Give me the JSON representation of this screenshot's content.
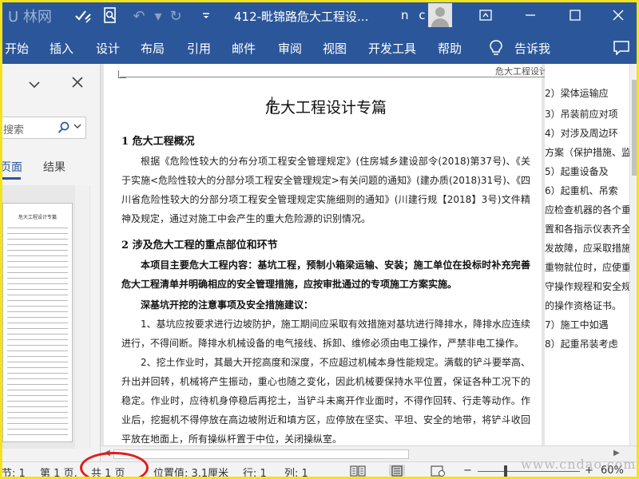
{
  "titlebar": {
    "watermark": "U 林网",
    "doc_title": "412-毗锦路危大工程设...",
    "user_initials": "n c"
  },
  "ribbon": {
    "tabs": [
      "开始",
      "插入",
      "设计",
      "布局",
      "引用",
      "邮件",
      "审阅",
      "视图",
      "开发工具",
      "帮助"
    ],
    "tell_me": "告诉我"
  },
  "nav_pane": {
    "search_placeholder": "搜索",
    "tab_pages": "页面",
    "tab_results": "结果",
    "thumb_title": "危大工程设计专篇"
  },
  "document": {
    "running_header": "危大工程设计专篇",
    "title": "危大工程设计专篇",
    "section1_heading": "1 危大工程概况",
    "section1_para": "根据《危险性较大的分布分项工程安全管理规定》(住房城乡建设部令(2018)第37号)、《关于实施<危险性较大的分部分项工程安全管理规定>有关问题的通知》(建办质(2018)31号)、《四川省危险性较大的分部分项工程安全管理规定实施细则的通知》(川建行规【2018】3号)文件精神及规定，通过对施工中会产生的重大危险源的识别情况。",
    "section2_heading": "2 涉及危大工程的重点部位和环节",
    "section2_para_bold": "本项目主要危大工程内容：基坑工程，预制小箱梁运输、安装；施工单位在投标时补充完善危大工程清单并明确相应的安全管理措施，应按审批通过的专项施工方案实施。",
    "subheading": "深基坑开挖的注意事项及安全措施建议：",
    "item1": "1、基坑应按要求进行边坡防护，施工期间应采取有效措施对基坑进行降排水，降排水应连续进行，不得间断。降排水机械设备的电气接线、拆卸、维修必须由电工操作，严禁非电工操作。",
    "item2": "2、挖土作业时，其最大开挖高度和深度，不应超过机械本身性能规定。满载的铲斗要举高、升出并回转，机械将产生振动，重心也随之变化，因此机械要保持水平位置，保证各种工况下的稳定。作业时，应待机身停稳后再挖土，当铲斗未离开作业面时，不得作回转、行走等动作。作业后，挖掘机不得停放在高边坡附近和填方区，应停放在坚实、平坦、安全的地带，将铲斗收回平放在地面上，所有操纵杆置于中位，关闭操纵室。",
    "right_column": [
      "2）梁体运输应",
      "3）吊装前应对项",
      "4）对涉及周边环",
      "方案（保护措施、监",
      "5）起重设备及",
      "6）起重机、吊索",
      "应检查机器的各个重",
      "置和各指示仪表齐全",
      "发故障，应采取措施",
      "重物就位时，应使重",
      "守操作规程和安全规",
      "的操作资格证书。",
      "7）施工中如遇",
      "8）起重吊装考虑"
    ]
  },
  "statusbar": {
    "section": "节: 1",
    "page": "第 1 页,",
    "total_pages": "共 1 页",
    "position": "位置值: 3.1厘米",
    "line": "行: 1",
    "column": "列: 1",
    "zoom": "60%",
    "zoom_level": 0.6
  },
  "watermark_bottom": "www.cndao.com",
  "colors": {
    "accent": "#2b579a",
    "frame": "#f2e31c",
    "highlight_circle": "#e21b1b"
  }
}
